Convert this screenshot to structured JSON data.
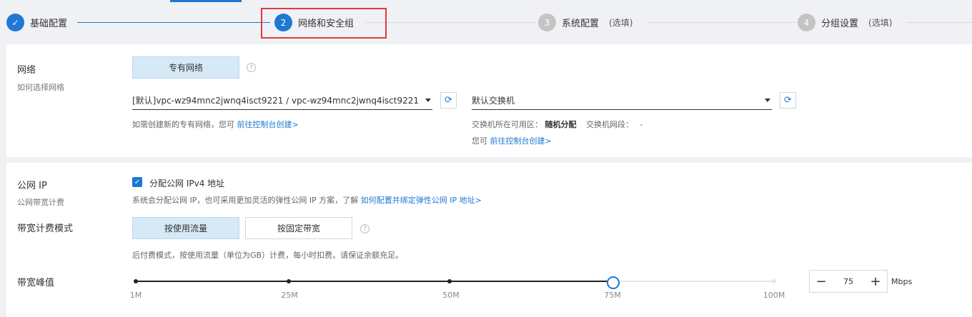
{
  "steps": [
    {
      "index": "✓",
      "label": "基础配置",
      "optional": ""
    },
    {
      "index": "2",
      "label": "网络和安全组",
      "optional": ""
    },
    {
      "index": "3",
      "label": "系统配置",
      "optional": "(选填)"
    },
    {
      "index": "4",
      "label": "分组设置",
      "optional": "(选填)"
    }
  ],
  "colors": {
    "accent": "#1f78d1",
    "highlight": "#e0393e",
    "done": "#1f78d1",
    "inactive": "#bfbfbf"
  },
  "network": {
    "title": "网络",
    "subtitle": "如何选择网络",
    "type_button": "专有网络",
    "vpc_value": "[默认]vpc-wz94mnc2jwnq4isct9221 / vpc-wz94mnc2jwnq4isct9221",
    "vpc_hint": "如需创建新的专有网络，您可",
    "vpc_hint_link": "前往控制台创建>",
    "switch_value": "默认交换机",
    "switch_zone_label": "交换机所在可用区：",
    "switch_zone_value": "随机分配",
    "switch_cidr_label": "交换机网段：",
    "switch_cidr_value": "-",
    "switch_hint": "您可",
    "switch_hint_link": "前往控制台创建>"
  },
  "public_ip": {
    "title": "公网 IP",
    "subtitle": "公网带宽计费",
    "checkbox_label": "分配公网 IPv4 地址",
    "desc": "系统会分配公网 IP，也可采用更加灵活的弹性公网 IP 方案，了解",
    "desc_link": "如何配置并绑定弹性公网 IP 地址>"
  },
  "billing": {
    "title": "带宽计费模式",
    "option_traffic": "按使用流量",
    "option_fixed": "按固定带宽",
    "desc": "后付费模式，按使用流量（单位为GB）计费，每小时扣费。请保证余额充足。"
  },
  "bandwidth": {
    "title": "带宽峰值",
    "ticks": [
      "1M",
      "25M",
      "50M",
      "75M",
      "100M"
    ],
    "value": "75",
    "unit": "Mbps",
    "minus": "−",
    "plus": "+"
  }
}
